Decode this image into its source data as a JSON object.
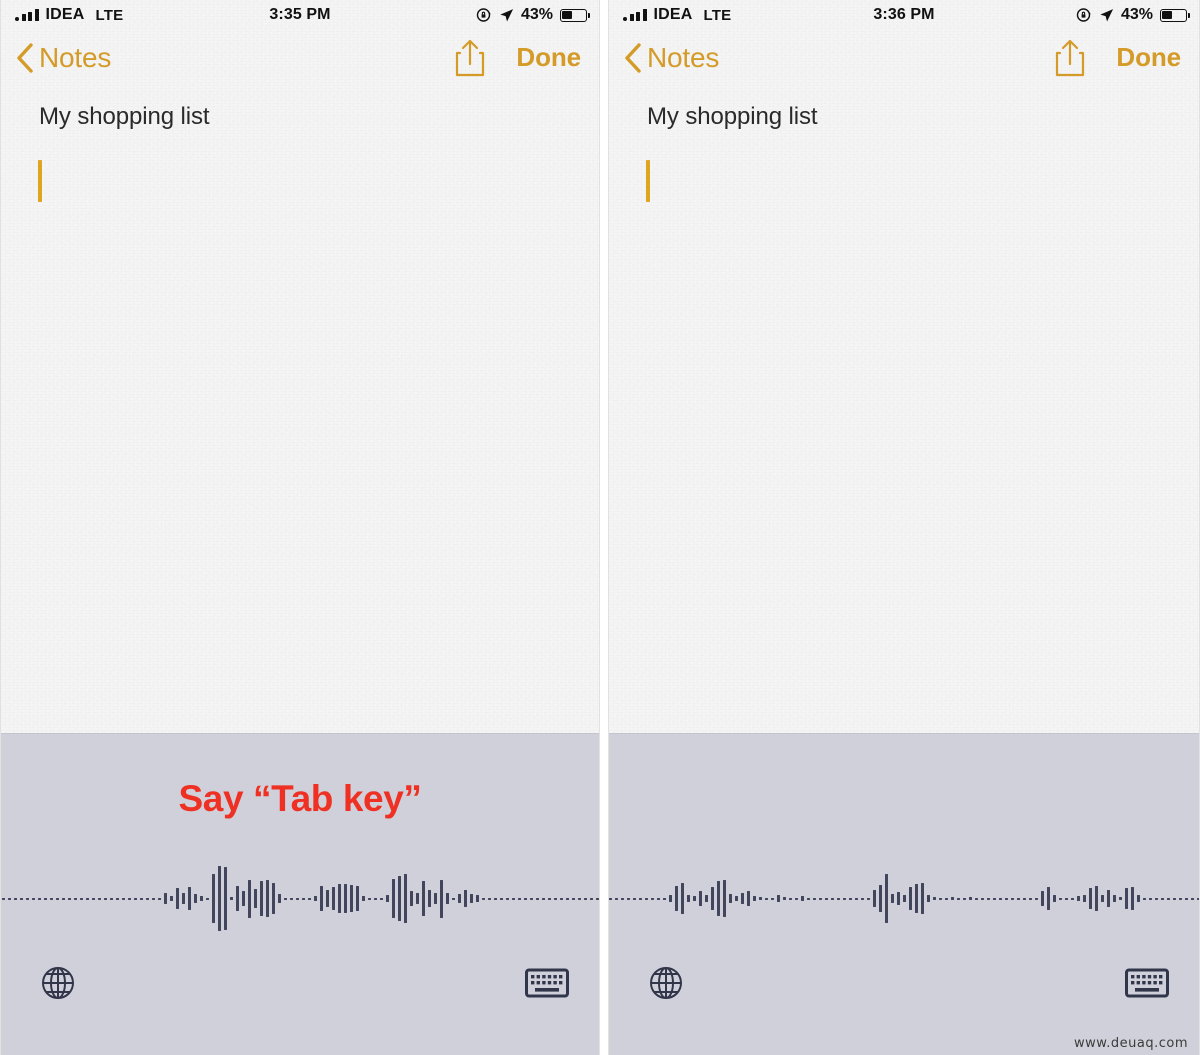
{
  "panels": [
    {
      "status": {
        "carrier": "IDEA",
        "network": "LTE",
        "time": "3:35 PM",
        "battery_percent": "43%",
        "rotation_lock": "rotation-lock-icon",
        "location": "location-arrow-icon"
      },
      "nav": {
        "back_label": "Notes",
        "share_label": "share-icon",
        "done_label": "Done"
      },
      "note": {
        "title": "My shopping list",
        "caret": "text-caret"
      },
      "dictation": {
        "hint": "Say “Tab key”",
        "hint_visible": true,
        "globe_label": "globe-icon",
        "keyboard_label": "keyboard-icon",
        "waveform": [
          1,
          1,
          1,
          1,
          1,
          1,
          1,
          1,
          1,
          1,
          1,
          1,
          1,
          1,
          1,
          1,
          1,
          1,
          1,
          1,
          1,
          1,
          1,
          1,
          1,
          1,
          1,
          6,
          3,
          11,
          6,
          12,
          5,
          3,
          1,
          26,
          34,
          33,
          2,
          13,
          8,
          20,
          10,
          18,
          19,
          16,
          5,
          1,
          1,
          1,
          1,
          1,
          3,
          13,
          9,
          12,
          15,
          15,
          14,
          13,
          3,
          1,
          1,
          1,
          4,
          21,
          24,
          26,
          8,
          6,
          18,
          9,
          6,
          20,
          6,
          1,
          5,
          9,
          5,
          4,
          1,
          1,
          1,
          1,
          1,
          1,
          1,
          1,
          1,
          1,
          1,
          1,
          1,
          1,
          1,
          1,
          1,
          1,
          1,
          1
        ]
      }
    },
    {
      "status": {
        "carrier": "IDEA",
        "network": "LTE",
        "time": "3:36 PM",
        "battery_percent": "43%",
        "rotation_lock": "rotation-lock-icon",
        "location": "location-arrow-icon"
      },
      "nav": {
        "back_label": "Notes",
        "share_label": "share-icon",
        "done_label": "Done"
      },
      "note": {
        "title": "My shopping list",
        "caret": "text-caret"
      },
      "dictation": {
        "hint": "",
        "hint_visible": false,
        "globe_label": "globe-icon",
        "keyboard_label": "keyboard-icon",
        "waveform": [
          1,
          1,
          1,
          1,
          1,
          1,
          1,
          1,
          1,
          1,
          1,
          1,
          1,
          1,
          1,
          1,
          1,
          1,
          1,
          1,
          1,
          1,
          4,
          13,
          16,
          4,
          3,
          8,
          4,
          12,
          18,
          19,
          5,
          3,
          6,
          8,
          3,
          2,
          1,
          1,
          4,
          2,
          1,
          1,
          3,
          1,
          1,
          1,
          1,
          1,
          1,
          1,
          1,
          1,
          1,
          1,
          9,
          14,
          26,
          5,
          7,
          4,
          12,
          15,
          16,
          4,
          2,
          1,
          1,
          2,
          1,
          1,
          2,
          1,
          1,
          1,
          1,
          1,
          1,
          1,
          1,
          1,
          1,
          1,
          8,
          12,
          4,
          1,
          1,
          1,
          3,
          4,
          11,
          13,
          4,
          9,
          4,
          2,
          11,
          12,
          4,
          1,
          1,
          1,
          1,
          1,
          1,
          1,
          1,
          1,
          1,
          1,
          1,
          1,
          1,
          1,
          1,
          1,
          1,
          1,
          1,
          1,
          1
        ]
      }
    }
  ],
  "watermark": "www.deuaq.com",
  "colors": {
    "accent": "#d49b28",
    "caret": "#e0a51e",
    "alert": "#ef3124",
    "dictation_bg": "#d0d0da",
    "wave": "#41465c",
    "paper": "#f5f5f5"
  }
}
